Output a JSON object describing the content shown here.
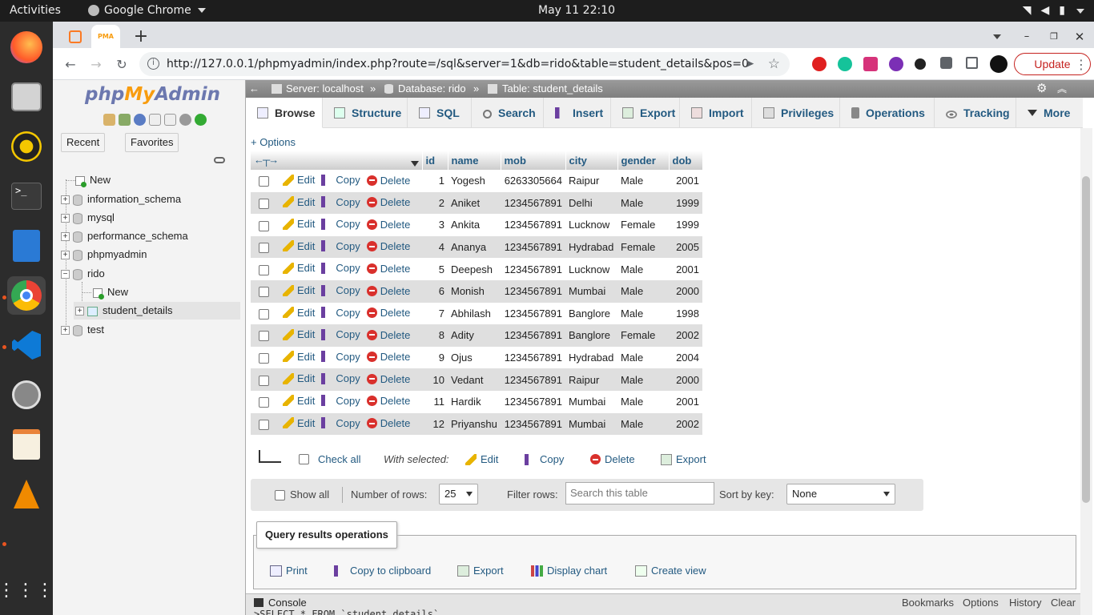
{
  "os": {
    "activities": "Activities",
    "app_name": "Google Chrome",
    "clock": "May 11  22:10"
  },
  "browser": {
    "url": "http://127.0.0.1/phpmyadmin/index.php?route=/sql&server=1&db=rido&table=student_details&pos=0",
    "update_label": "Update"
  },
  "nav": {
    "logo_php": "php",
    "logo_my": "My",
    "logo_admin": "Admin",
    "tabs": [
      "Recent",
      "Favorites"
    ],
    "tree": {
      "new": "New",
      "dbs": [
        "information_schema",
        "mysql",
        "performance_schema",
        "phpmyadmin"
      ],
      "current_db": "rido",
      "current_new": "New",
      "current_table": "student_details",
      "last_db": "test"
    }
  },
  "breadcrumb": {
    "server": "Server: localhost",
    "database": "Database: rido",
    "table": "Table: student_details",
    "sep": "»"
  },
  "menu": [
    "Browse",
    "Structure",
    "SQL",
    "Search",
    "Insert",
    "Export",
    "Import",
    "Privileges",
    "Operations",
    "Tracking",
    "More"
  ],
  "options_label": "+ Options",
  "table": {
    "columns": [
      "id",
      "name",
      "mob",
      "city",
      "gender",
      "dob"
    ],
    "action_labels": {
      "edit": "Edit",
      "copy": "Copy",
      "delete": "Delete"
    },
    "rows": [
      [
        "1",
        "Yogesh",
        "6263305664",
        "Raipur",
        "Male",
        "2001"
      ],
      [
        "2",
        "Aniket",
        "1234567891",
        "Delhi",
        "Male",
        "1999"
      ],
      [
        "3",
        "Ankita",
        "1234567891",
        "Lucknow",
        "Female",
        "1999"
      ],
      [
        "4",
        "Ananya",
        "1234567891",
        "Hydrabad",
        "Female",
        "2005"
      ],
      [
        "5",
        "Deepesh",
        "1234567891",
        "Lucknow",
        "Male",
        "2001"
      ],
      [
        "6",
        "Monish",
        "1234567891",
        "Mumbai",
        "Male",
        "2000"
      ],
      [
        "7",
        "Abhilash",
        "1234567891",
        "Banglore",
        "Male",
        "1998"
      ],
      [
        "8",
        "Adity",
        "1234567891",
        "Banglore",
        "Female",
        "2002"
      ],
      [
        "9",
        "Ojus",
        "1234567891",
        "Hydrabad",
        "Male",
        "2004"
      ],
      [
        "10",
        "Vedant",
        "1234567891",
        "Raipur",
        "Male",
        "2000"
      ],
      [
        "11",
        "Hardik",
        "1234567891",
        "Mumbai",
        "Male",
        "2001"
      ],
      [
        "12",
        "Priyanshu",
        "1234567891",
        "Mumbai",
        "Male",
        "2002"
      ]
    ]
  },
  "bulk": {
    "check_all": "Check all",
    "with_selected": "With selected:",
    "edit": "Edit",
    "copy": "Copy",
    "delete": "Delete",
    "export": "Export"
  },
  "navbar": {
    "show_all": "Show all",
    "rows_label": "Number of rows:",
    "rows_value": "25",
    "filter_label": "Filter rows:",
    "filter_placeholder": "Search this table",
    "sort_label": "Sort by key:",
    "sort_value": "None"
  },
  "qro": {
    "legend": "Query results operations",
    "items": [
      "Print",
      "Copy to clipboard",
      "Export",
      "Display chart",
      "Create view"
    ]
  },
  "console": {
    "label": "Console",
    "links": [
      "Bookmarks",
      "Options",
      "History",
      "Clear"
    ],
    "query": ">SELECT * FROM `student_details`"
  }
}
